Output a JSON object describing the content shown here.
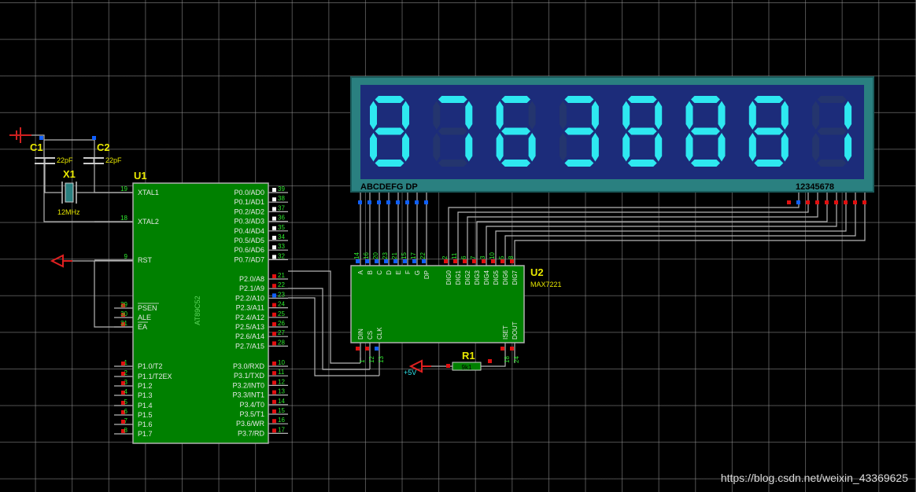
{
  "display": {
    "digits": [
      "8",
      "7",
      "6",
      "3",
      "8",
      "8",
      "8",
      "1"
    ],
    "bottom_left_label": "ABCDEFG  DP",
    "bottom_right_label": "12345678",
    "colors": {
      "frame": "#2a8080",
      "face": "#1c2c7a",
      "segment_on": "#2ee8f0",
      "segment_off": "#24356e"
    }
  },
  "u1": {
    "ref": "U1",
    "part": "AT89C52",
    "left_pins": [
      {
        "num": "19",
        "name": "XTAL1"
      },
      {
        "num": "18",
        "name": "XTAL2"
      },
      {
        "num": "9",
        "name": "RST"
      },
      {
        "num": "29",
        "name": "PSEN"
      },
      {
        "num": "30",
        "name": "ALE"
      },
      {
        "num": "31",
        "name": "EA"
      },
      {
        "num": "1",
        "name": "P1.0/T2"
      },
      {
        "num": "2",
        "name": "P1.1/T2EX"
      },
      {
        "num": "3",
        "name": "P1.2"
      },
      {
        "num": "4",
        "name": "P1.3"
      },
      {
        "num": "5",
        "name": "P1.4"
      },
      {
        "num": "6",
        "name": "P1.5"
      },
      {
        "num": "7",
        "name": "P1.6"
      },
      {
        "num": "8",
        "name": "P1.7"
      }
    ],
    "right_pins": [
      {
        "num": "39",
        "name": "P0.0/AD0"
      },
      {
        "num": "38",
        "name": "P0.1/AD1"
      },
      {
        "num": "37",
        "name": "P0.2/AD2"
      },
      {
        "num": "36",
        "name": "P0.3/AD3"
      },
      {
        "num": "35",
        "name": "P0.4/AD4"
      },
      {
        "num": "34",
        "name": "P0.5/AD5"
      },
      {
        "num": "33",
        "name": "P0.6/AD6"
      },
      {
        "num": "32",
        "name": "P0.7/AD7"
      },
      {
        "num": "21",
        "name": "P2.0/A8"
      },
      {
        "num": "22",
        "name": "P2.1/A9"
      },
      {
        "num": "23",
        "name": "P2.2/A10"
      },
      {
        "num": "24",
        "name": "P2.3/A11"
      },
      {
        "num": "25",
        "name": "P2.4/A12"
      },
      {
        "num": "26",
        "name": "P2.5/A13"
      },
      {
        "num": "27",
        "name": "P2.6/A14"
      },
      {
        "num": "28",
        "name": "P2.7/A15"
      },
      {
        "num": "10",
        "name": "P3.0/RXD"
      },
      {
        "num": "11",
        "name": "P3.1/TXD"
      },
      {
        "num": "12",
        "name": "P3.2/INT0"
      },
      {
        "num": "13",
        "name": "P3.3/INT1"
      },
      {
        "num": "14",
        "name": "P3.4/T0"
      },
      {
        "num": "15",
        "name": "P3.5/T1"
      },
      {
        "num": "16",
        "name": "P3.6/WR"
      },
      {
        "num": "17",
        "name": "P3.7/RD"
      }
    ]
  },
  "u2": {
    "ref": "U2",
    "part": "MAX7221",
    "top_pins": [
      {
        "num": "14",
        "name": "A"
      },
      {
        "num": "16",
        "name": "B"
      },
      {
        "num": "20",
        "name": "C"
      },
      {
        "num": "23",
        "name": "D"
      },
      {
        "num": "21",
        "name": "E"
      },
      {
        "num": "15",
        "name": "F"
      },
      {
        "num": "17",
        "name": "G"
      },
      {
        "num": "22",
        "name": "DP"
      },
      {
        "num": "2",
        "name": "DIG0"
      },
      {
        "num": "11",
        "name": "DIG1"
      },
      {
        "num": "6",
        "name": "DIG2"
      },
      {
        "num": "7",
        "name": "DIG3"
      },
      {
        "num": "3",
        "name": "DIG4"
      },
      {
        "num": "10",
        "name": "DIG5"
      },
      {
        "num": "5",
        "name": "DIG6"
      },
      {
        "num": "8",
        "name": "DIG7"
      }
    ],
    "bottom_pins": [
      {
        "num": "1",
        "name": "DIN"
      },
      {
        "num": "12",
        "name": "CS"
      },
      {
        "num": "13",
        "name": "CLK"
      },
      {
        "num": "18",
        "name": "ISET"
      },
      {
        "num": "24",
        "name": "DOUT"
      }
    ]
  },
  "c1": {
    "ref": "C1",
    "value": "22pF"
  },
  "c2": {
    "ref": "C2",
    "value": "22pF"
  },
  "x1": {
    "ref": "X1",
    "value": "12MHz"
  },
  "r1": {
    "ref": "R1",
    "value": "9k1"
  },
  "power_label": "+5V",
  "watermark": "https://blog.csdn.net/weixin_43369625"
}
